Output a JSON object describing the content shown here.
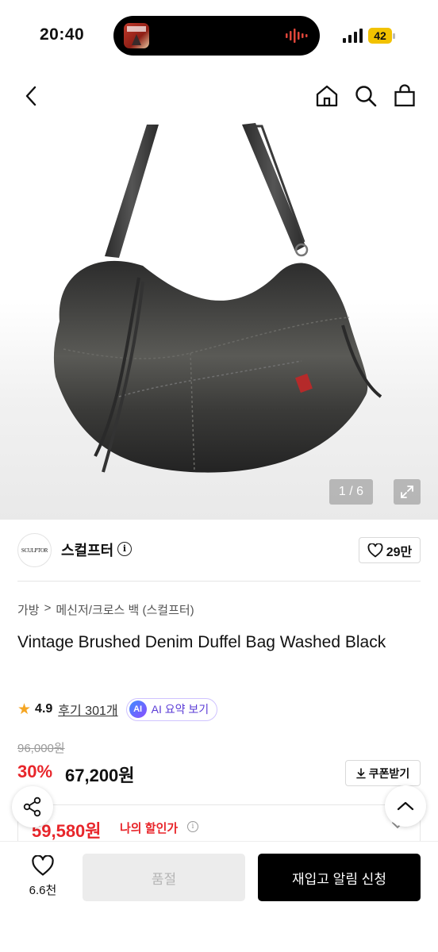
{
  "status_bar": {
    "time": "20:40",
    "battery": "42"
  },
  "product_gallery": {
    "pager": "1 / 6"
  },
  "brand": {
    "logo_text": "SCULPTOR",
    "name": "스컬프터",
    "likes": "29만"
  },
  "breadcrumb": [
    "가방",
    "메신저/크로스 백 (스컬프터)"
  ],
  "breadcrumb_sep": ">",
  "product": {
    "title": "Vintage Brushed Denim Duffel Bag Washed Black",
    "rating": "4.9",
    "reviews": "후기 301개",
    "ai_badge": "AI",
    "ai_summary": "AI 요약 보기",
    "original_price": "96,000원",
    "discount": "30%",
    "price": "67,200원",
    "coupon": "쿠폰받기",
    "my_price": "59,580원",
    "my_price_label": "나의 할인가"
  },
  "bottom_bar": {
    "wish_count": "6.6천",
    "soldout": "품절",
    "restock": "재입고 알림 신청"
  },
  "colors": {
    "accent_red": "#e8262b",
    "star": "#f5a623",
    "ai_purple": "#5a3bd6",
    "battery": "#f2c200"
  },
  "icons": [
    "back-arrow-icon",
    "home-icon",
    "search-icon",
    "shopping-bag-icon",
    "expand-icon",
    "info-icon",
    "heart-icon",
    "star-icon",
    "download-icon",
    "chevron-down-icon",
    "share-icon",
    "chevron-up-icon"
  ]
}
